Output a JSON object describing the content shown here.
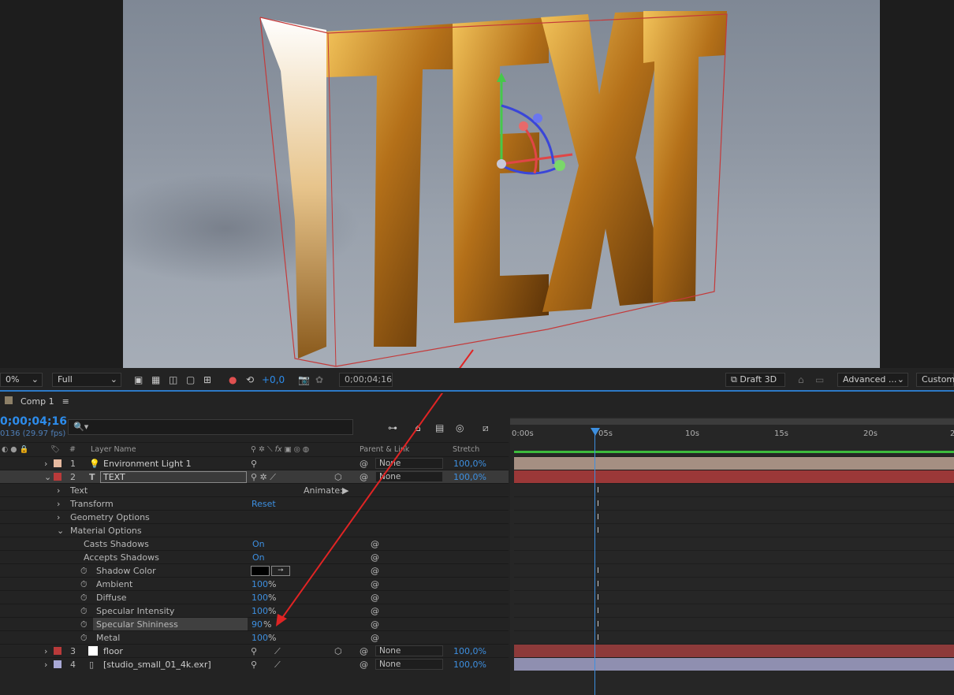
{
  "viewport": {
    "scene_text": "TEXT"
  },
  "viewer_bar": {
    "zoom": "0%",
    "resolution": "Full",
    "exposure": "+0,0",
    "timecode": "0;00;04;16",
    "renderer": "Draft 3D",
    "advanced": "Advanced ...",
    "custom": "Custom"
  },
  "panel": {
    "tab": "Comp 1",
    "menu": "≡",
    "timecode": "0;00;04;16",
    "frame_info": "0136 (29.97 fps)",
    "search_placeholder": "🔍▾"
  },
  "columns": {
    "num": "#",
    "name": "Layer Name",
    "parent": "Parent & Link",
    "stretch": "Stretch",
    "fx": "fx"
  },
  "layers": [
    {
      "num": "1",
      "icon": "💡",
      "name": "Environment Light 1",
      "parent": "None",
      "stretch": "100,0%",
      "color": "#e6b99f"
    },
    {
      "num": "2",
      "icon": "T",
      "name": "TEXT",
      "parent": "None",
      "stretch": "100,0%",
      "color": "#b93a3a"
    },
    {
      "num": "3",
      "icon": "",
      "name": "floor",
      "parent": "None",
      "stretch": "100,0%",
      "color": "#b93a3a"
    },
    {
      "num": "4",
      "icon": "",
      "name": "[studio_small_01_4k.exr]",
      "parent": "None",
      "stretch": "100,0%",
      "color": "#a9a9d6"
    }
  ],
  "props": {
    "text": "Text",
    "animate": "Animate:",
    "transform": "Transform",
    "reset": "Reset",
    "geometry": "Geometry Options",
    "material": "Material Options",
    "casts": "Casts Shadows",
    "casts_v": "On",
    "accepts": "Accepts Shadows",
    "accepts_v": "On",
    "shadow_color": "Shadow Color",
    "ambient": "Ambient",
    "ambient_v": "100",
    "diffuse": "Diffuse",
    "diffuse_v": "100",
    "spec_int": "Specular Intensity",
    "spec_int_v": "100",
    "spec_shine": "Specular Shininess",
    "spec_shine_v": "90",
    "metal": "Metal",
    "metal_v": "100",
    "pct": "%"
  },
  "ruler": {
    "labels": [
      "0:00s",
      "05s",
      "10s",
      "15s",
      "20s",
      "2"
    ]
  },
  "colors": {
    "accent": "#2d8ceb",
    "arrow": "#e02424",
    "light_bar": "#a58f82",
    "text_bar": "#9b3838",
    "floor_bar": "#8d3a3a",
    "env_bar": "#8f8fb0"
  }
}
